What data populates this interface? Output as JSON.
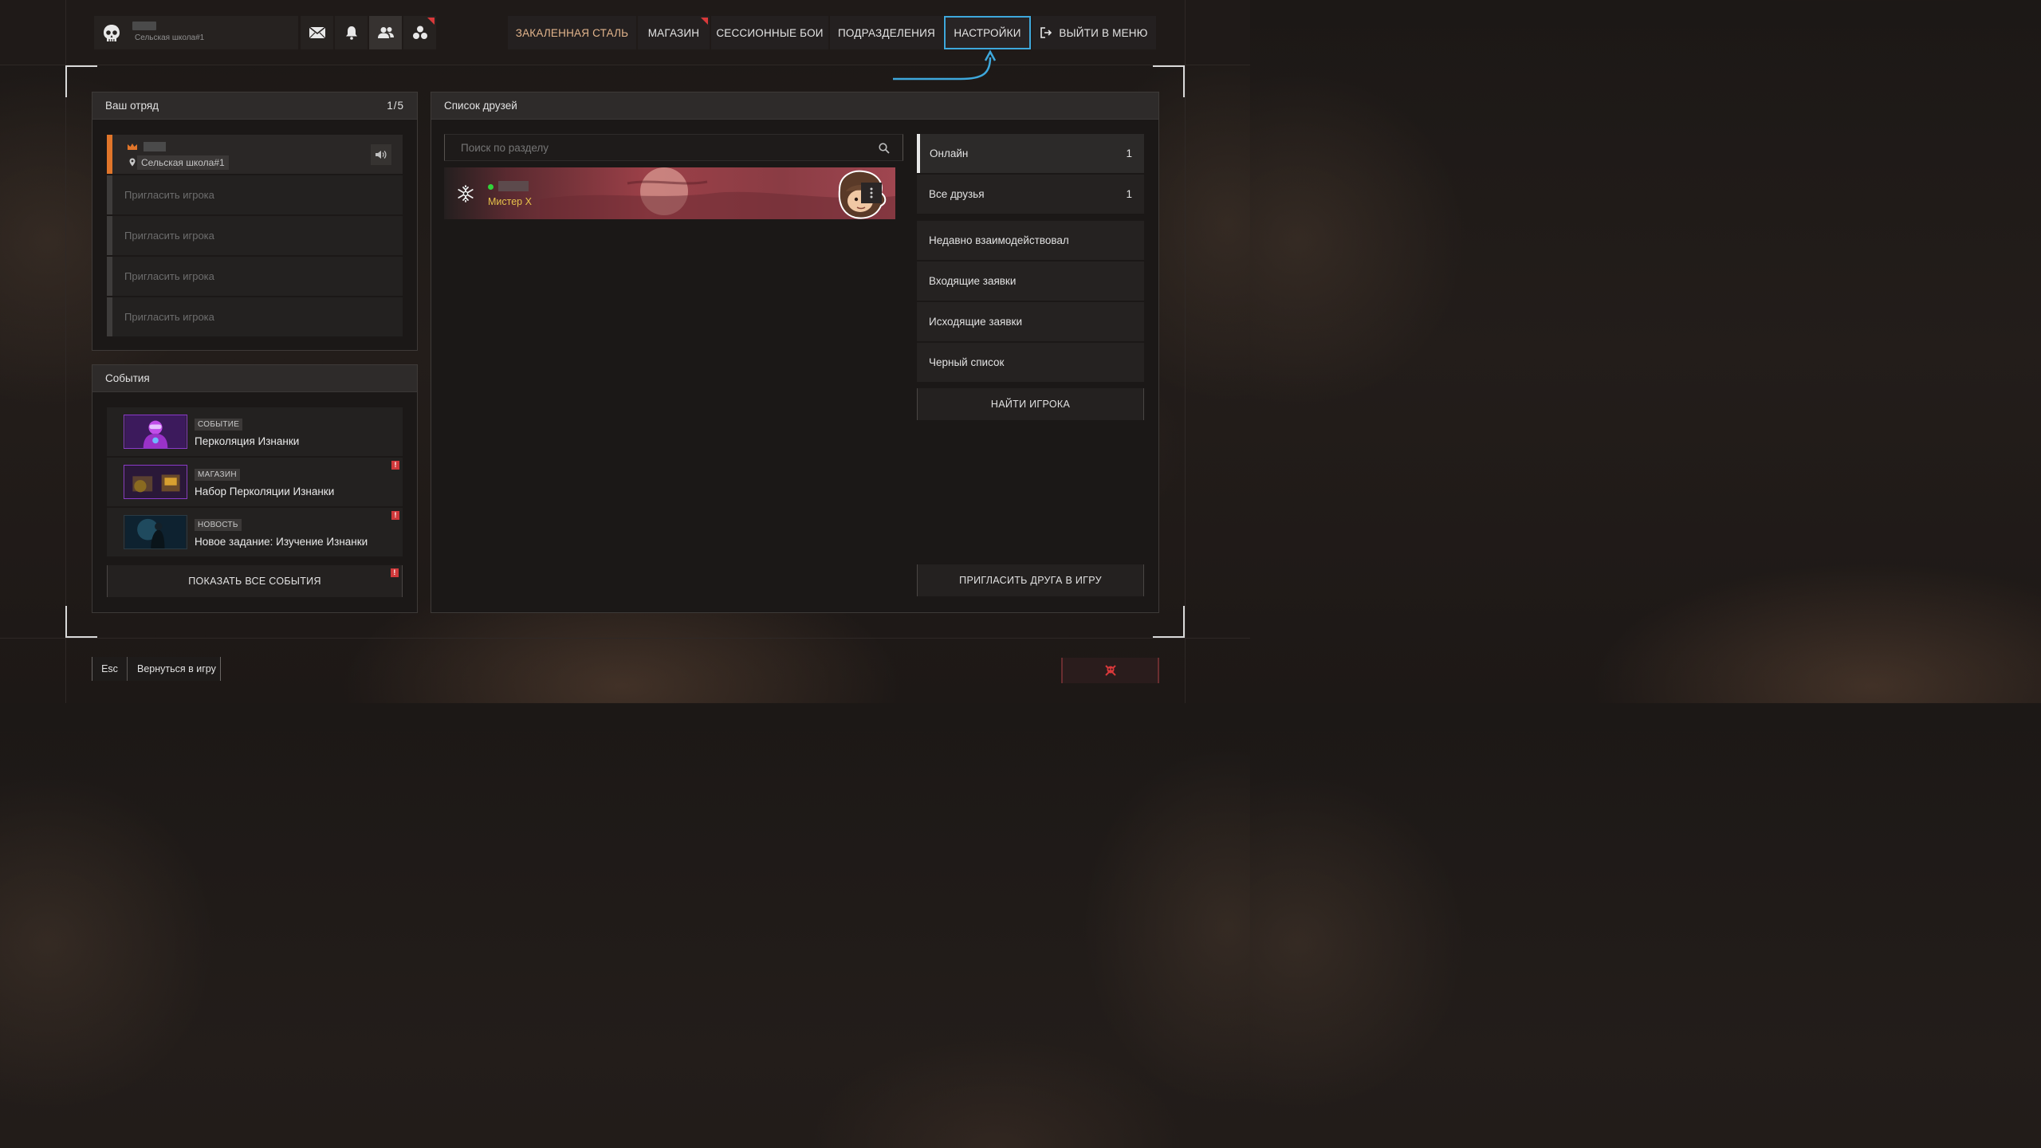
{
  "profile": {
    "school": "Сельская школа#1"
  },
  "top_icons": [
    {
      "name": "mail-icon"
    },
    {
      "name": "bell-icon"
    },
    {
      "name": "friends-icon"
    },
    {
      "name": "group-icon"
    }
  ],
  "nav": {
    "hardened_steel": "ЗАКАЛЕННАЯ СТАЛЬ",
    "shop": "МАГАЗИН",
    "session_battles": "СЕССИОННЫЕ БОИ",
    "divisions": "ПОДРАЗДЕЛЕНИЯ",
    "settings": "НАСТРОЙКИ",
    "exit": "ВЫЙТИ В МЕНЮ"
  },
  "squad": {
    "title": "Ваш отряд",
    "count": "1/5",
    "leader_school": "Сельская школа#1",
    "invite_label": "Пригласить игрока"
  },
  "events": {
    "title": "События",
    "items": [
      {
        "tag": "СОБЫТИЕ",
        "title": "Перколяция Изнанки"
      },
      {
        "tag": "МАГАЗИН",
        "title": "Набор Перколяции Изнанки"
      },
      {
        "tag": "НОВОСТЬ",
        "title": "Новое задание: Изучение Изнанки"
      }
    ],
    "show_all": "ПОКАЗАТЬ ВСЕ СОБЫТИЯ",
    "warn_mark": "!"
  },
  "friends": {
    "title": "Список друзей",
    "search_placeholder": "Поиск по разделу",
    "friend_title": "Мистер X",
    "filters": [
      {
        "label": "Онлайн",
        "count": "1"
      },
      {
        "label": "Все друзья",
        "count": "1"
      },
      {
        "label": "Недавно взаимодействовал",
        "count": ""
      },
      {
        "label": "Входящие заявки",
        "count": ""
      },
      {
        "label": "Исходящие заявки",
        "count": ""
      },
      {
        "label": "Черный список",
        "count": ""
      }
    ],
    "find_player": "НАЙТИ ИГРОКА",
    "invite_friend": "ПРИГЛАСИТЬ ДРУГА В ИГРУ"
  },
  "footer": {
    "esc_key": "Esc",
    "return_label": "Вернуться в игру"
  },
  "colors": {
    "accent_orange": "#e0752a",
    "selected_border": "#3ea8dc",
    "online_dot": "#31d33a",
    "friend_title": "#e6c14a",
    "alert_red": "#d0393b"
  }
}
